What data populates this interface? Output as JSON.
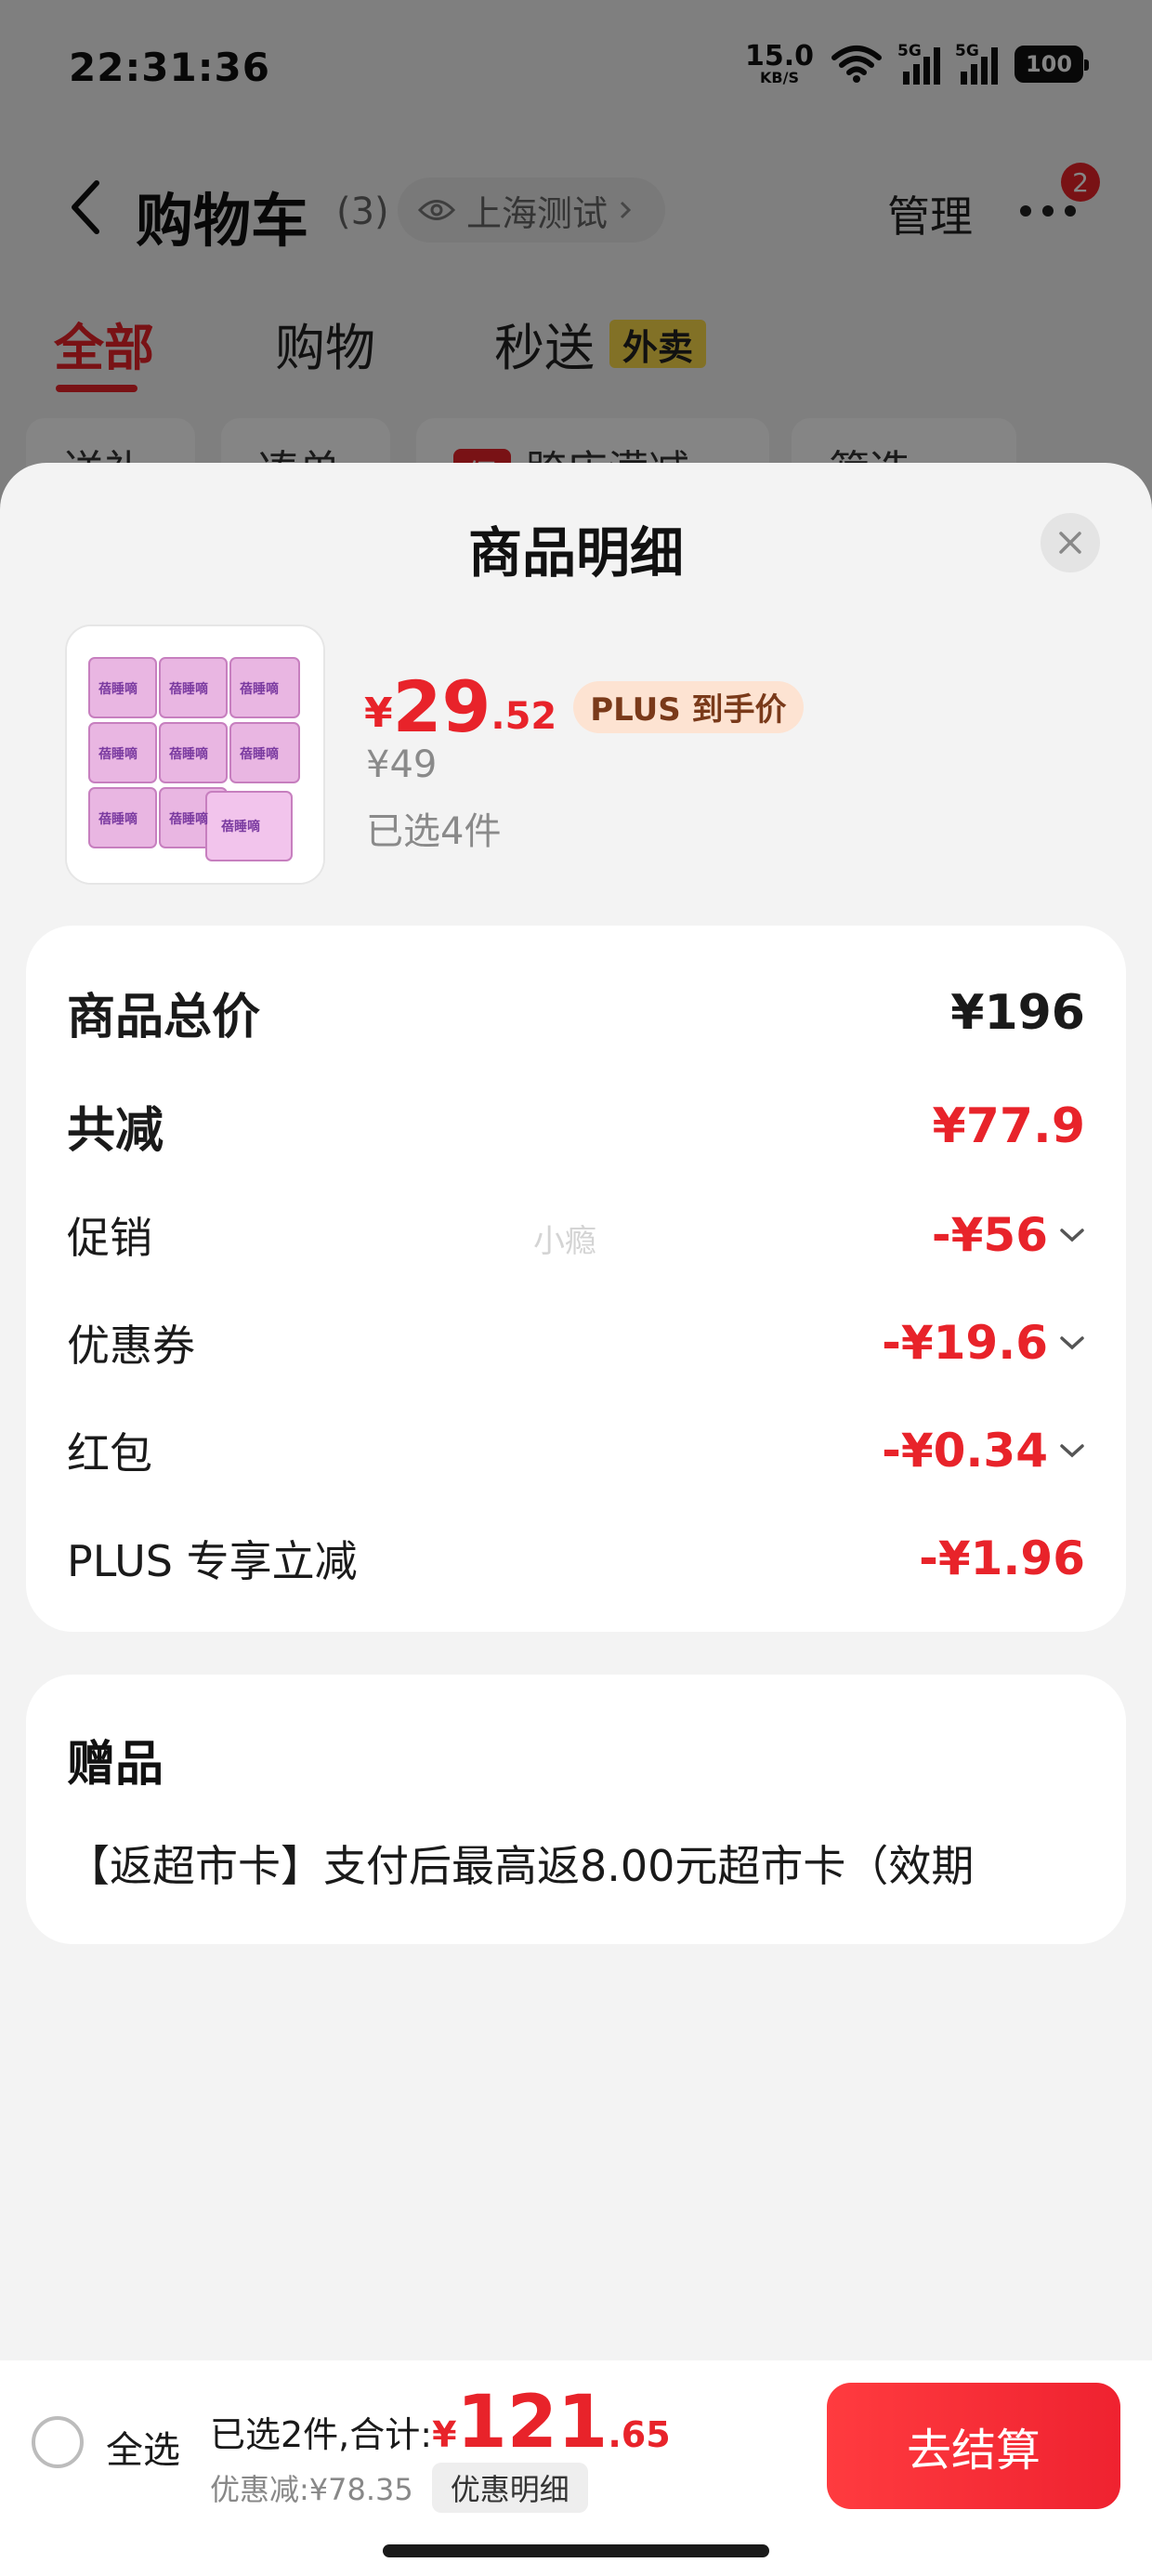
{
  "status_bar": {
    "time": "22:31:36",
    "net_speed_value": "15.0",
    "net_speed_unit": "KB/S",
    "signal1_label": "5G",
    "signal2_label": "5G",
    "battery": "100"
  },
  "nav": {
    "title": "购物车",
    "count": "(3)",
    "location": "上海测试",
    "manage_label": "管理",
    "more_badge": "2"
  },
  "tabs": [
    {
      "label": "全部",
      "active": true
    },
    {
      "label": "购物"
    },
    {
      "label": "秒送",
      "tag": "外卖"
    }
  ],
  "filters": [
    {
      "label": "送礼"
    },
    {
      "label": "凑单"
    },
    {
      "label": "跨店满减",
      "promo": "促"
    },
    {
      "label": "筛选"
    }
  ],
  "sheet": {
    "title": "商品明细",
    "product": {
      "image_text": "蓓睡嘀",
      "price_symbol": "¥",
      "price_int": "29",
      "price_dec": ".52",
      "plus_tag": "PLUS 到手价",
      "original_price": "¥49",
      "selected_qty": "已选4件"
    },
    "summary": {
      "total_label": "商品总价",
      "total_value": "¥196",
      "reduce_label": "共减",
      "reduce_value": "¥77.9",
      "watermark": "小瘾",
      "lines": [
        {
          "label": "促销",
          "value": "-¥56"
        },
        {
          "label": "优惠券",
          "value": "-¥19.6"
        },
        {
          "label": "红包",
          "value": "-¥0.34"
        },
        {
          "label": "PLUS 专享立减",
          "value": "-¥1.96"
        }
      ]
    },
    "gift": {
      "title": "赠品",
      "text": "【返超市卡】支付后最高返8.00元超市卡（效期"
    }
  },
  "bottom_bar": {
    "select_all": "全选",
    "selected_text": "已选2件,合计:",
    "total_symbol": "¥",
    "total_int": "121",
    "total_dec": ".65",
    "discount_text": "优惠减:¥78.35",
    "detail_button": "优惠明细",
    "checkout_button": "去结算"
  },
  "colors": {
    "accent_red": "#e8232a",
    "plus_tag_bg": "#fde3d2",
    "waimai_tag_bg": "#f9d949"
  }
}
